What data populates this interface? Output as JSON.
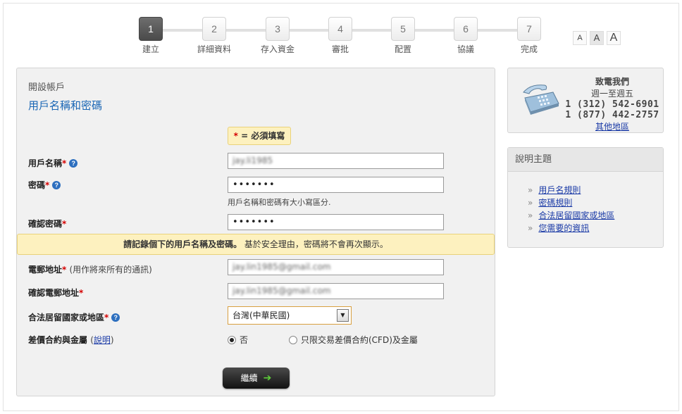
{
  "stepper": {
    "steps": [
      {
        "number": "1",
        "label": "建立",
        "active": true
      },
      {
        "number": "2",
        "label": "詳細資料"
      },
      {
        "number": "3",
        "label": "存入資金"
      },
      {
        "number": "4",
        "label": "審批"
      },
      {
        "number": "5",
        "label": "配置"
      },
      {
        "number": "6",
        "label": "協議"
      },
      {
        "number": "7",
        "label": "完成"
      }
    ]
  },
  "font_size": {
    "small": "A",
    "medium": "A",
    "large": "A"
  },
  "form": {
    "section_title": "開設帳戶",
    "subtitle": "用戶名稱和密碼",
    "required_note": {
      "star": "*",
      "text": " = 必須填寫"
    },
    "required_star": "*",
    "help_glyph": "?",
    "username": {
      "label": "用戶名稱",
      "value": "jay.li1985"
    },
    "password": {
      "label": "密碼",
      "value": "•••••••"
    },
    "password_hint": "用戶名稱和密碼有大小寫區分.",
    "confirm_password": {
      "label": "確認密碼",
      "value": "•••••••"
    },
    "warning": {
      "bold": "請記錄個下的用戶名稱及密碼。",
      "text": " 基於安全理由，密碼將不會再次顯示。"
    },
    "email": {
      "label": "電郵地址",
      "note": "(用作將來所有的通訊)",
      "value": "jay.lin1985@gmail.com"
    },
    "confirm_email": {
      "label": "確認電郵地址",
      "value": "jay.lin1985@gmail.com"
    },
    "country": {
      "label": "合法居留國家或地區",
      "value": "台灣(中華民國)",
      "arrow": "▼"
    },
    "cfd": {
      "label": "差價合約與金屬",
      "link_open": "(",
      "link": "說明",
      "link_close": ")",
      "option_no": "否",
      "option_only": "只限交易差價合約(CFD)及金屬",
      "selected": "否"
    },
    "continue_button": {
      "label": "繼續",
      "arrow": "➔"
    }
  },
  "contact": {
    "title": "致電我們",
    "hours": "週一至週五",
    "phone1": "1 (312) 542-6901",
    "phone2": "1 (877) 442-2757",
    "more_link": "其他地區"
  },
  "help_topics": {
    "title": "說明主題",
    "chevron": "»",
    "items": [
      "用戶名規則",
      "密碼規則",
      "合法居留國家或地區",
      "您需要的資訊"
    ]
  },
  "colors": {
    "link": "#1a3aa6",
    "subtitle": "#1a66b5",
    "required_star": "#d40000",
    "notice_bg": "#fdf1bf",
    "panel_bg": "#f1f1f1"
  }
}
